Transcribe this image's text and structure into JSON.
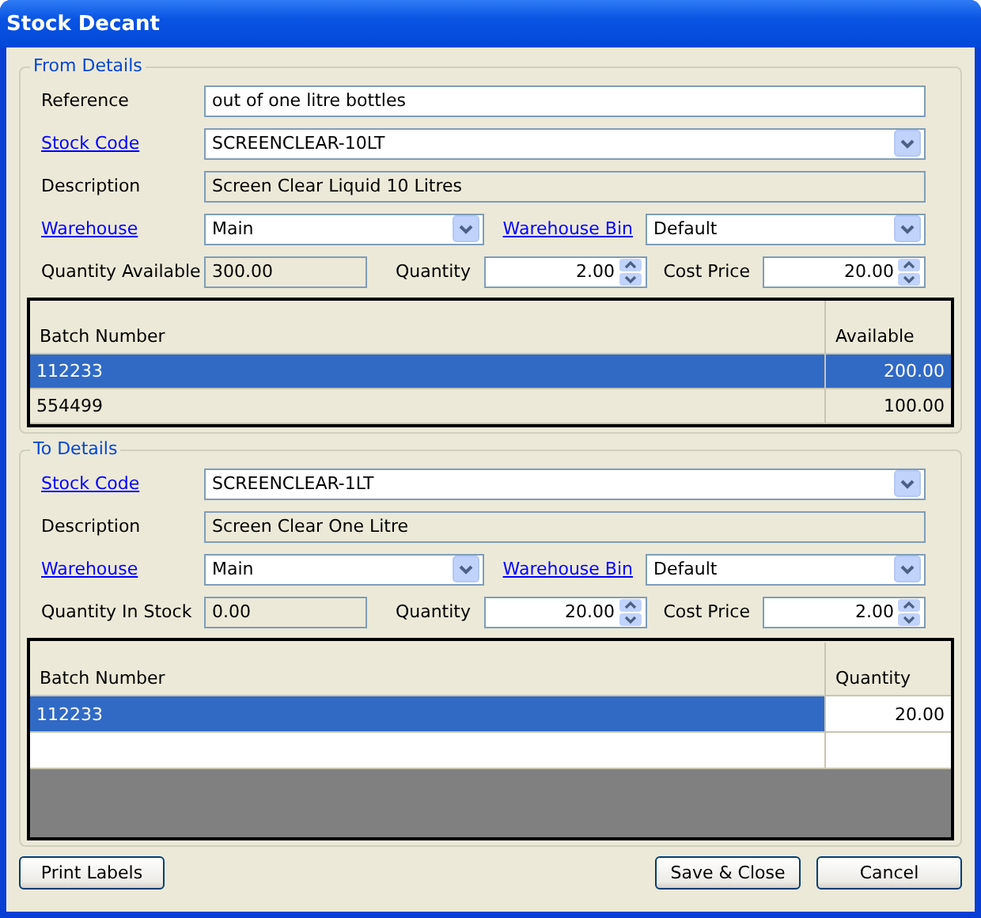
{
  "window": {
    "title": "Stock Decant"
  },
  "sections": [
    {
      "legend": "From Details",
      "rows": [
        {
          "fields": [
            {
              "label": "Reference",
              "link": false,
              "kind": "text",
              "value": "out of one litre bottles"
            }
          ]
        },
        {
          "fields": [
            {
              "label": "Stock Code",
              "link": true,
              "kind": "combo",
              "value": "SCREENCLEAR-10LT"
            }
          ]
        },
        {
          "fields": [
            {
              "label": "Description",
              "link": false,
              "kind": "readonly",
              "value": "Screen Clear Liquid 10 Litres"
            }
          ]
        },
        {
          "fields": [
            {
              "label": "Warehouse",
              "link": true,
              "kind": "combo",
              "value": "Main"
            },
            {
              "label": "Warehouse Bin",
              "link": true,
              "kind": "combo",
              "value": "Default"
            }
          ]
        },
        {
          "fields": [
            {
              "label": "Quantity Available",
              "link": false,
              "kind": "readonly",
              "value": "300.00"
            },
            {
              "label": "Quantity",
              "link": false,
              "kind": "spin",
              "value": "2.00"
            },
            {
              "label": "Cost Price",
              "link": false,
              "kind": "spin",
              "value": "20.00"
            }
          ]
        }
      ],
      "table": {
        "columns": [
          {
            "label": "Batch Number",
            "editable": false
          },
          {
            "label": "Available",
            "editable": false
          }
        ],
        "rows": [
          {
            "cells": [
              "112233",
              "200.00"
            ],
            "selected": true
          },
          {
            "cells": [
              "554499",
              "100.00"
            ],
            "selected": false
          }
        ]
      }
    },
    {
      "legend": "To Details",
      "rows": [
        {
          "fields": [
            {
              "label": "Stock Code",
              "link": true,
              "kind": "combo",
              "value": "SCREENCLEAR-1LT"
            }
          ]
        },
        {
          "fields": [
            {
              "label": "Description",
              "link": false,
              "kind": "readonly",
              "value": "Screen Clear One Litre"
            }
          ]
        },
        {
          "fields": [
            {
              "label": "Warehouse",
              "link": true,
              "kind": "combo",
              "value": "Main"
            },
            {
              "label": "Warehouse Bin",
              "link": true,
              "kind": "combo",
              "value": "Default"
            }
          ]
        },
        {
          "fields": [
            {
              "label": "Quantity In Stock",
              "link": false,
              "kind": "readonly",
              "value": "0.00"
            },
            {
              "label": "Quantity",
              "link": false,
              "kind": "spin",
              "value": "20.00"
            },
            {
              "label": "Cost Price",
              "link": false,
              "kind": "spin",
              "value": "2.00"
            }
          ]
        }
      ],
      "table": {
        "columns": [
          {
            "label": "Batch Number",
            "editable": false
          },
          {
            "label": "Quantity",
            "editable": true
          }
        ],
        "rows": [
          {
            "cells": [
              "112233",
              "20.00"
            ],
            "selected": true
          }
        ],
        "new_row": true
      }
    }
  ],
  "buttons": [
    {
      "label": "Print Labels"
    },
    {
      "label": "Save & Close"
    },
    {
      "label": "Cancel"
    }
  ]
}
